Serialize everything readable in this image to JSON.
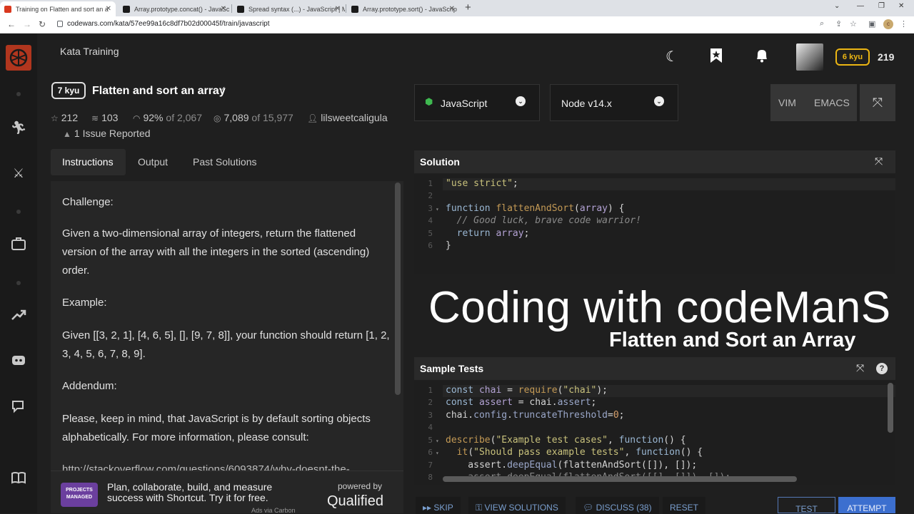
{
  "browser": {
    "tabs": [
      {
        "title": "Training on Flatten and sort an a",
        "active": true,
        "fav_color": "#d9381e"
      },
      {
        "title": "Array.prototype.concat() - JavaSc",
        "active": false,
        "fav_color": "#1b1b1b"
      },
      {
        "title": "Spread syntax (...) - JavaScript | M",
        "active": false,
        "fav_color": "#1b1b1b"
      },
      {
        "title": "Array.prototype.sort() - JavaScrip",
        "active": false,
        "fav_color": "#1b1b1b"
      }
    ],
    "new_tab": "+",
    "url": "codewars.com/kata/57ee99a16c8df7b02d00045f/train/javascript",
    "profile_initial": "c"
  },
  "header": {
    "section": "Kata Training",
    "rank": "6 kyu",
    "honor": "219"
  },
  "kata": {
    "kyu": "7 kyu",
    "title": "Flatten and sort an array",
    "stats": {
      "stars": "212",
      "collections": "103",
      "satisfaction_pct": "92%",
      "satisfaction_of": "of 2,067",
      "completed": "7,089",
      "completed_of": "of 15,977",
      "author": "lilsweetcaligula"
    },
    "issues": "1 Issue Reported"
  },
  "instruction_tabs": [
    "Instructions",
    "Output",
    "Past Solutions"
  ],
  "description": {
    "p1": "Challenge:",
    "p2": "Given a two-dimensional array of integers, return the flattened version of the array with all the integers in the sorted (ascending) order.",
    "p3": "Example:",
    "p4": "Given [[3, 2, 1], [4, 6, 5], [], [9, 7, 8]], your function should return [1, 2, 3, 4, 5, 6, 7, 8, 9].",
    "p5": "Addendum:",
    "p6": "Please, keep in mind, that JavaScript is by default sorting objects alphabetically. For more information, please consult:",
    "p7": "http://stackoverflow.com/questions/6093874/why-doesnt-the-"
  },
  "ad": {
    "logo": "PROJECTS MANAGED",
    "text": "Plan, collaborate, build, and measure success with Shortcut. Try it for free.",
    "small": "Ads via Carbon",
    "powered": "powered by",
    "brand": "Qualified"
  },
  "editor_toolbar": {
    "language": "JavaScript",
    "version": "Node v14.x",
    "vim": "VIM",
    "emacs": "EMACS"
  },
  "solution": {
    "title": "Solution",
    "lines": [
      "1",
      "2",
      "3",
      "4",
      "5",
      "6"
    ]
  },
  "overlay": {
    "line1": "Coding with codeManS",
    "line2": "Flatten and Sort an Array"
  },
  "sample_tests": {
    "title": "Sample Tests",
    "help": "?",
    "lines": [
      "1",
      "2",
      "3",
      "4",
      "5",
      "6",
      "7",
      "8"
    ]
  },
  "actions": {
    "skip": "SKIP",
    "view_solutions": "VIEW SOLUTIONS",
    "discuss": "DISCUSS (38)",
    "reset": "RESET",
    "test": "TEST",
    "attempt": "ATTEMPT"
  },
  "colors": {
    "brand": "#b1361e",
    "rank_yellow": "#ecb613",
    "attempt_blue": "#3c6fcf"
  }
}
